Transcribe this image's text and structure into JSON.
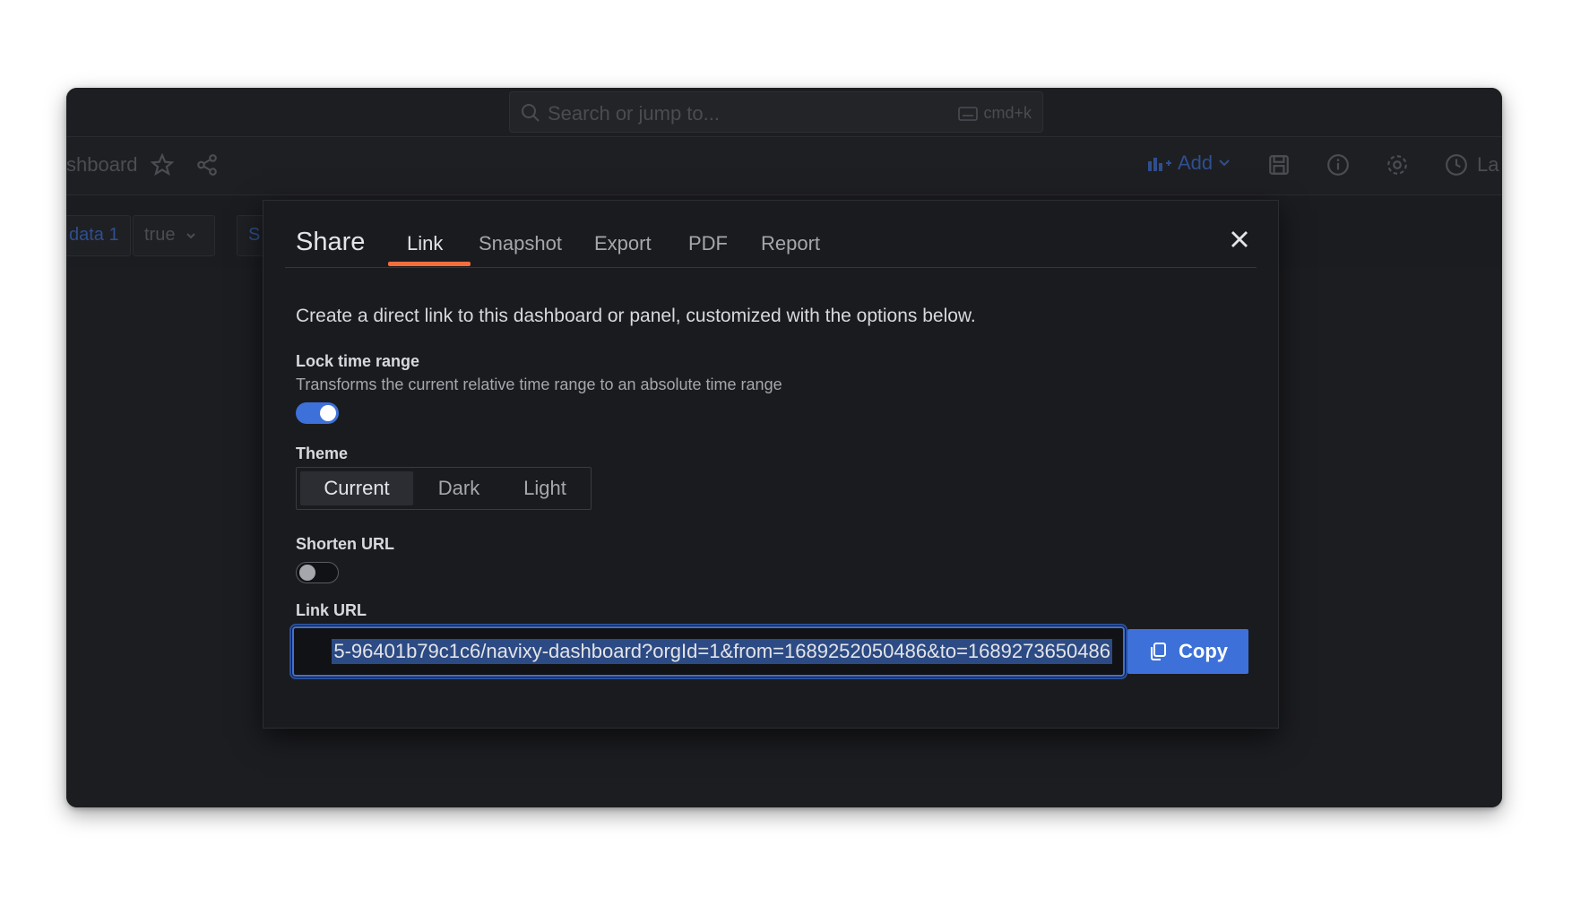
{
  "topbar": {
    "search_placeholder": "Search or jump to...",
    "shortcut": "cmd+k"
  },
  "navbar": {
    "breadcrumb_fragment": "shboard",
    "add_label": "Add",
    "time_fragment": "La"
  },
  "variables": {
    "chip1": "data 1",
    "chip2": "true",
    "chip3": "S"
  },
  "share_modal": {
    "title": "Share",
    "tabs": [
      {
        "label": "Link"
      },
      {
        "label": "Snapshot"
      },
      {
        "label": "Export"
      },
      {
        "label": "PDF"
      },
      {
        "label": "Report"
      }
    ],
    "active_tab": "Link",
    "description": "Create a direct link to this dashboard or panel, customized with the options below.",
    "lock_time_range": {
      "label": "Lock time range",
      "description": "Transforms the current relative time range to an absolute time range",
      "enabled": true
    },
    "theme": {
      "label": "Theme",
      "options": [
        "Current",
        "Dark",
        "Light"
      ],
      "selected": "Current"
    },
    "shorten_url": {
      "label": "Shorten URL",
      "enabled": false
    },
    "link_url": {
      "label": "Link URL",
      "value": "5-96401b79c1c6/navixy-dashboard?orgId=1&from=1689252050486&to=1689273650486"
    },
    "copy_label": "Copy"
  },
  "colors": {
    "accent": "#3d71d9",
    "tab_underline": "#f46d3c",
    "modal_bg": "#1a1b1f"
  }
}
